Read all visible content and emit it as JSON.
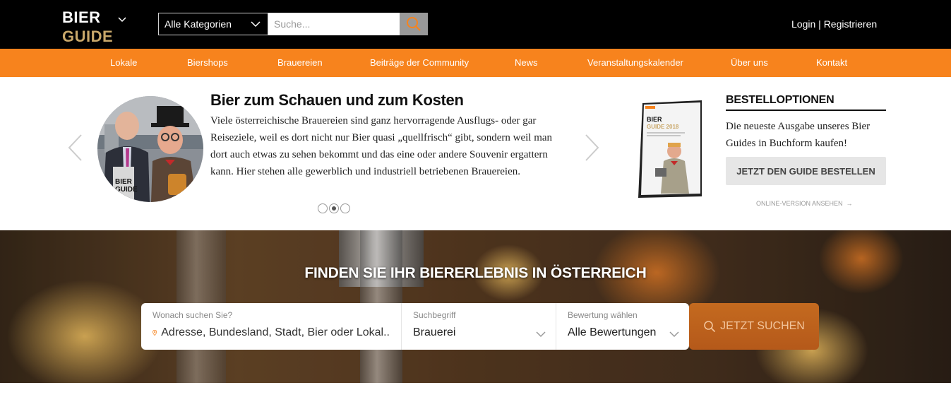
{
  "header": {
    "logo_line1": "BIER",
    "logo_line2": "GUIDE",
    "category_select": "Alle Kategorien",
    "search_placeholder": "Suche...",
    "login": "Login",
    "separator": " | ",
    "register": "Registrieren"
  },
  "nav": {
    "items": [
      {
        "label": "Lokale"
      },
      {
        "label": "Biershops"
      },
      {
        "label": "Brauereien"
      },
      {
        "label": "Beiträge der Community"
      },
      {
        "label": "News"
      },
      {
        "label": "Veranstaltungskalender"
      },
      {
        "label": "Über uns"
      },
      {
        "label": "Kontakt"
      }
    ]
  },
  "slider": {
    "title": "Bier zum Schauen und zum Kosten",
    "text": "Viele österreichische Brauereien sind ganz hervorragende Ausflugs- oder gar Reiseziele, weil es dort nicht nur Bier quasi „quellfrisch“ gibt, sondern weil man dort auch etwas zu sehen bekommt und das eine oder andere Souvenir ergattern kann. Hier stehen alle gewerblich und industriell betriebenen Brauereien.",
    "active_slide": 2,
    "slide_count": 3
  },
  "order": {
    "title": "BESTELLOPTIONEN",
    "text": "Die neueste Ausgabe unseres Bier Guides in Buchform kaufen!",
    "button": "JETZT DEN GUIDE BESTELLEN",
    "online_link": "ONLINE-VERSION ANSEHEN"
  },
  "book": {
    "brand": "BIER",
    "subtitle": "GUIDE 2018"
  },
  "hero": {
    "title": "FINDEN SIE IHR BIERERLEBNIS IN ÖSTERREICH",
    "where_label": "Wonach suchen Sie?",
    "where_placeholder": "Adresse, Bundesland, Stadt, Bier oder Lokal..",
    "term_label": "Suchbegriff",
    "term_value": "Brauerei",
    "rating_label": "Bewertung wählen",
    "rating_value": "Alle Bewertungen",
    "search_button": "JETZT SUCHEN"
  },
  "colors": {
    "brand_orange": "#f7831d",
    "logo_gold": "#c9a86a",
    "header_bg": "#000000"
  }
}
